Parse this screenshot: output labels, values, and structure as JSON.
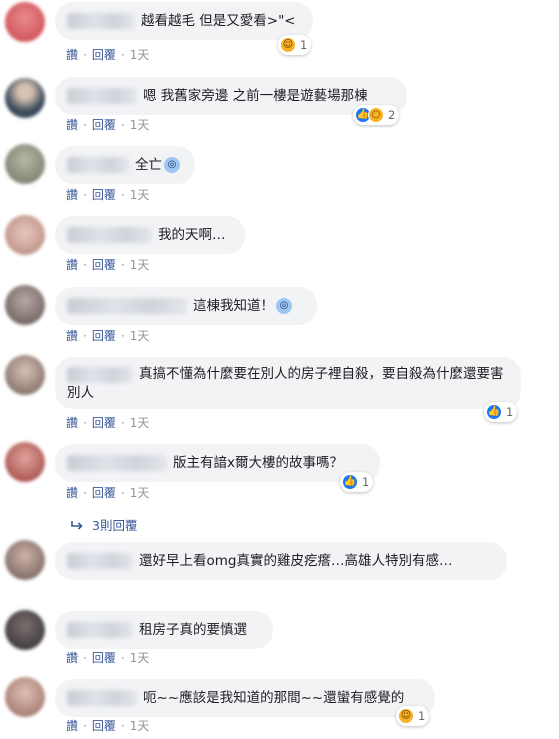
{
  "actions": {
    "like": "讚",
    "reply": "回覆",
    "dot": "·"
  },
  "comments": [
    {
      "text": "越看越毛 但是又愛看>\"<",
      "time": "1天",
      "reaction_count": "1",
      "reaction_icons": [
        "haha-icon"
      ],
      "avatar_color": "#d9595f"
    },
    {
      "text": "嗯 我舊家旁邊 之前一樓是遊藝場那棟",
      "time": "1天",
      "reaction_count": "2",
      "reaction_icons": [
        "like-icon",
        "wow-icon"
      ],
      "avatar_color": "#4a5a6a"
    },
    {
      "text": "全亡",
      "time": "1天",
      "reaction_count": "",
      "reaction_icons": [],
      "avatar_color": "#8a8f7a",
      "inline_emoji": "scream-emoji"
    },
    {
      "text": "我的天啊…",
      "time": "1天",
      "reaction_count": "",
      "reaction_icons": [],
      "avatar_color": "#c7a19a"
    },
    {
      "text": "這棟我知道！",
      "time": "1天",
      "reaction_count": "",
      "reaction_icons": [],
      "avatar_color": "#7a6a68",
      "inline_emoji": "scream-emoji"
    },
    {
      "text": "真搞不懂為什麼要在別人的房子裡自殺，要自殺為什麼還要害別人",
      "time": "1天",
      "reaction_count": "1",
      "reaction_icons": [
        "like-icon"
      ],
      "avatar_color": "#6f5f59"
    },
    {
      "text": "版主有諳x爾大樓的故事嗎？",
      "time": "1天",
      "reaction_count": "1",
      "reaction_icons": [
        "like-icon"
      ],
      "avatar_color": "#b8544f"
    },
    {
      "text": "還好早上看omg真實的雞皮疙瘩…高雄人特別有感…",
      "time": "",
      "reaction_count": "",
      "reaction_icons": [],
      "avatar_color": "#8a7670"
    },
    {
      "text": "租房子真的要慎選",
      "time": "1天",
      "reaction_count": "",
      "reaction_icons": [],
      "avatar_color": "#3e3a3a"
    },
    {
      "text": "呃~~應該是我知道的那間~~還蠻有感覺的",
      "time": "1天",
      "reaction_count": "1",
      "reaction_icons": [
        "haha-icon"
      ],
      "avatar_color": "#b8867a"
    }
  ],
  "replies_link": {
    "label": "3則回覆"
  },
  "colors": {
    "bubble": "#f2f3f5",
    "link": "#385898",
    "muted": "#90949c",
    "like_blue": "#1877f2",
    "emoji_yellow": "#f7b125"
  }
}
